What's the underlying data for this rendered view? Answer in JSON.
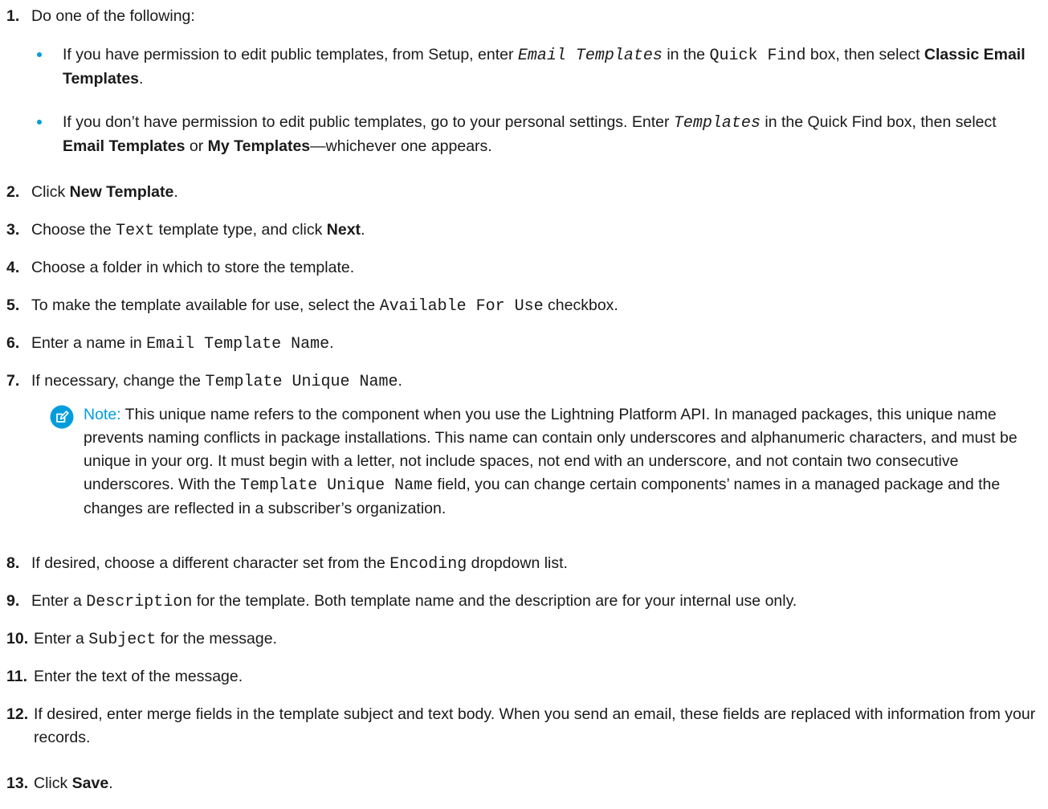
{
  "steps": [
    {
      "num": "1.",
      "text": "Do one of the following:"
    },
    {
      "num": "2.",
      "text": "Click ",
      "bold": "New Template",
      "end": "."
    },
    {
      "num": "3.",
      "pre": "Choose the ",
      "code": "Text",
      "mid": " template type, and click ",
      "bold": "Next",
      "end": "."
    },
    {
      "num": "4.",
      "text": "Choose a folder in which to store the template."
    },
    {
      "num": "5.",
      "pre": "To make the template available for use, select the ",
      "code": "Available For Use",
      "end": " checkbox."
    },
    {
      "num": "6.",
      "pre": "Enter a name in ",
      "code": "Email Template Name",
      "end": "."
    },
    {
      "num": "7.",
      "pre": "If necessary, change the ",
      "code": "Template Unique Name",
      "end": "."
    },
    {
      "num": "8.",
      "pre": "If desired, choose a different character set from the ",
      "code": "Encoding",
      "end": " dropdown list."
    },
    {
      "num": "9.",
      "pre": "Enter a ",
      "code": "Description",
      "end": " for the template. Both template name and the description are for your internal use only."
    },
    {
      "num": "10.",
      "pre": "Enter a ",
      "code": "Subject",
      "end": " for the message."
    },
    {
      "num": "11.",
      "text": "Enter the text of the message."
    },
    {
      "num": "12.",
      "text": "If desired, enter merge fields in the template subject and text body. When you send an email, these fields are replaced with information from your records."
    },
    {
      "num": "13.",
      "text": "Click ",
      "bold": "Save",
      "end": "."
    }
  ],
  "bullets": [
    {
      "a": "If you have permission to edit public templates, from Setup, enter ",
      "code": "Email Templates",
      "b": " in the ",
      "code2": "Quick Find",
      "c": " box, then select ",
      "bold": "Classic Email Templates",
      "end": "."
    },
    {
      "a": "If you don’t have permission to edit public templates, go to your personal settings. Enter ",
      "code": "Templates",
      "b": " in the Quick Find box, then select ",
      "bold": "Email Templates",
      "c": " or ",
      "bold2": "My Templates",
      "end": "—whichever one appears."
    }
  ],
  "note": {
    "label": "Note:",
    "icon": "edit-note-icon",
    "text1": " This unique name refers to the component when you use the Lightning Platform API. In managed packages, this unique name prevents naming conflicts in package installations. This name can contain only underscores and alphanumeric characters, and must be unique in your org. It must begin with a letter, not include spaces, not end with an underscore, and not contain two consecutive underscores. With the ",
    "code": "Template Unique Name",
    "text2": " field, you can change certain components’ names in a managed package and the changes are reflected in a subscriber’s organization.",
    "accent": "#009ddc"
  }
}
